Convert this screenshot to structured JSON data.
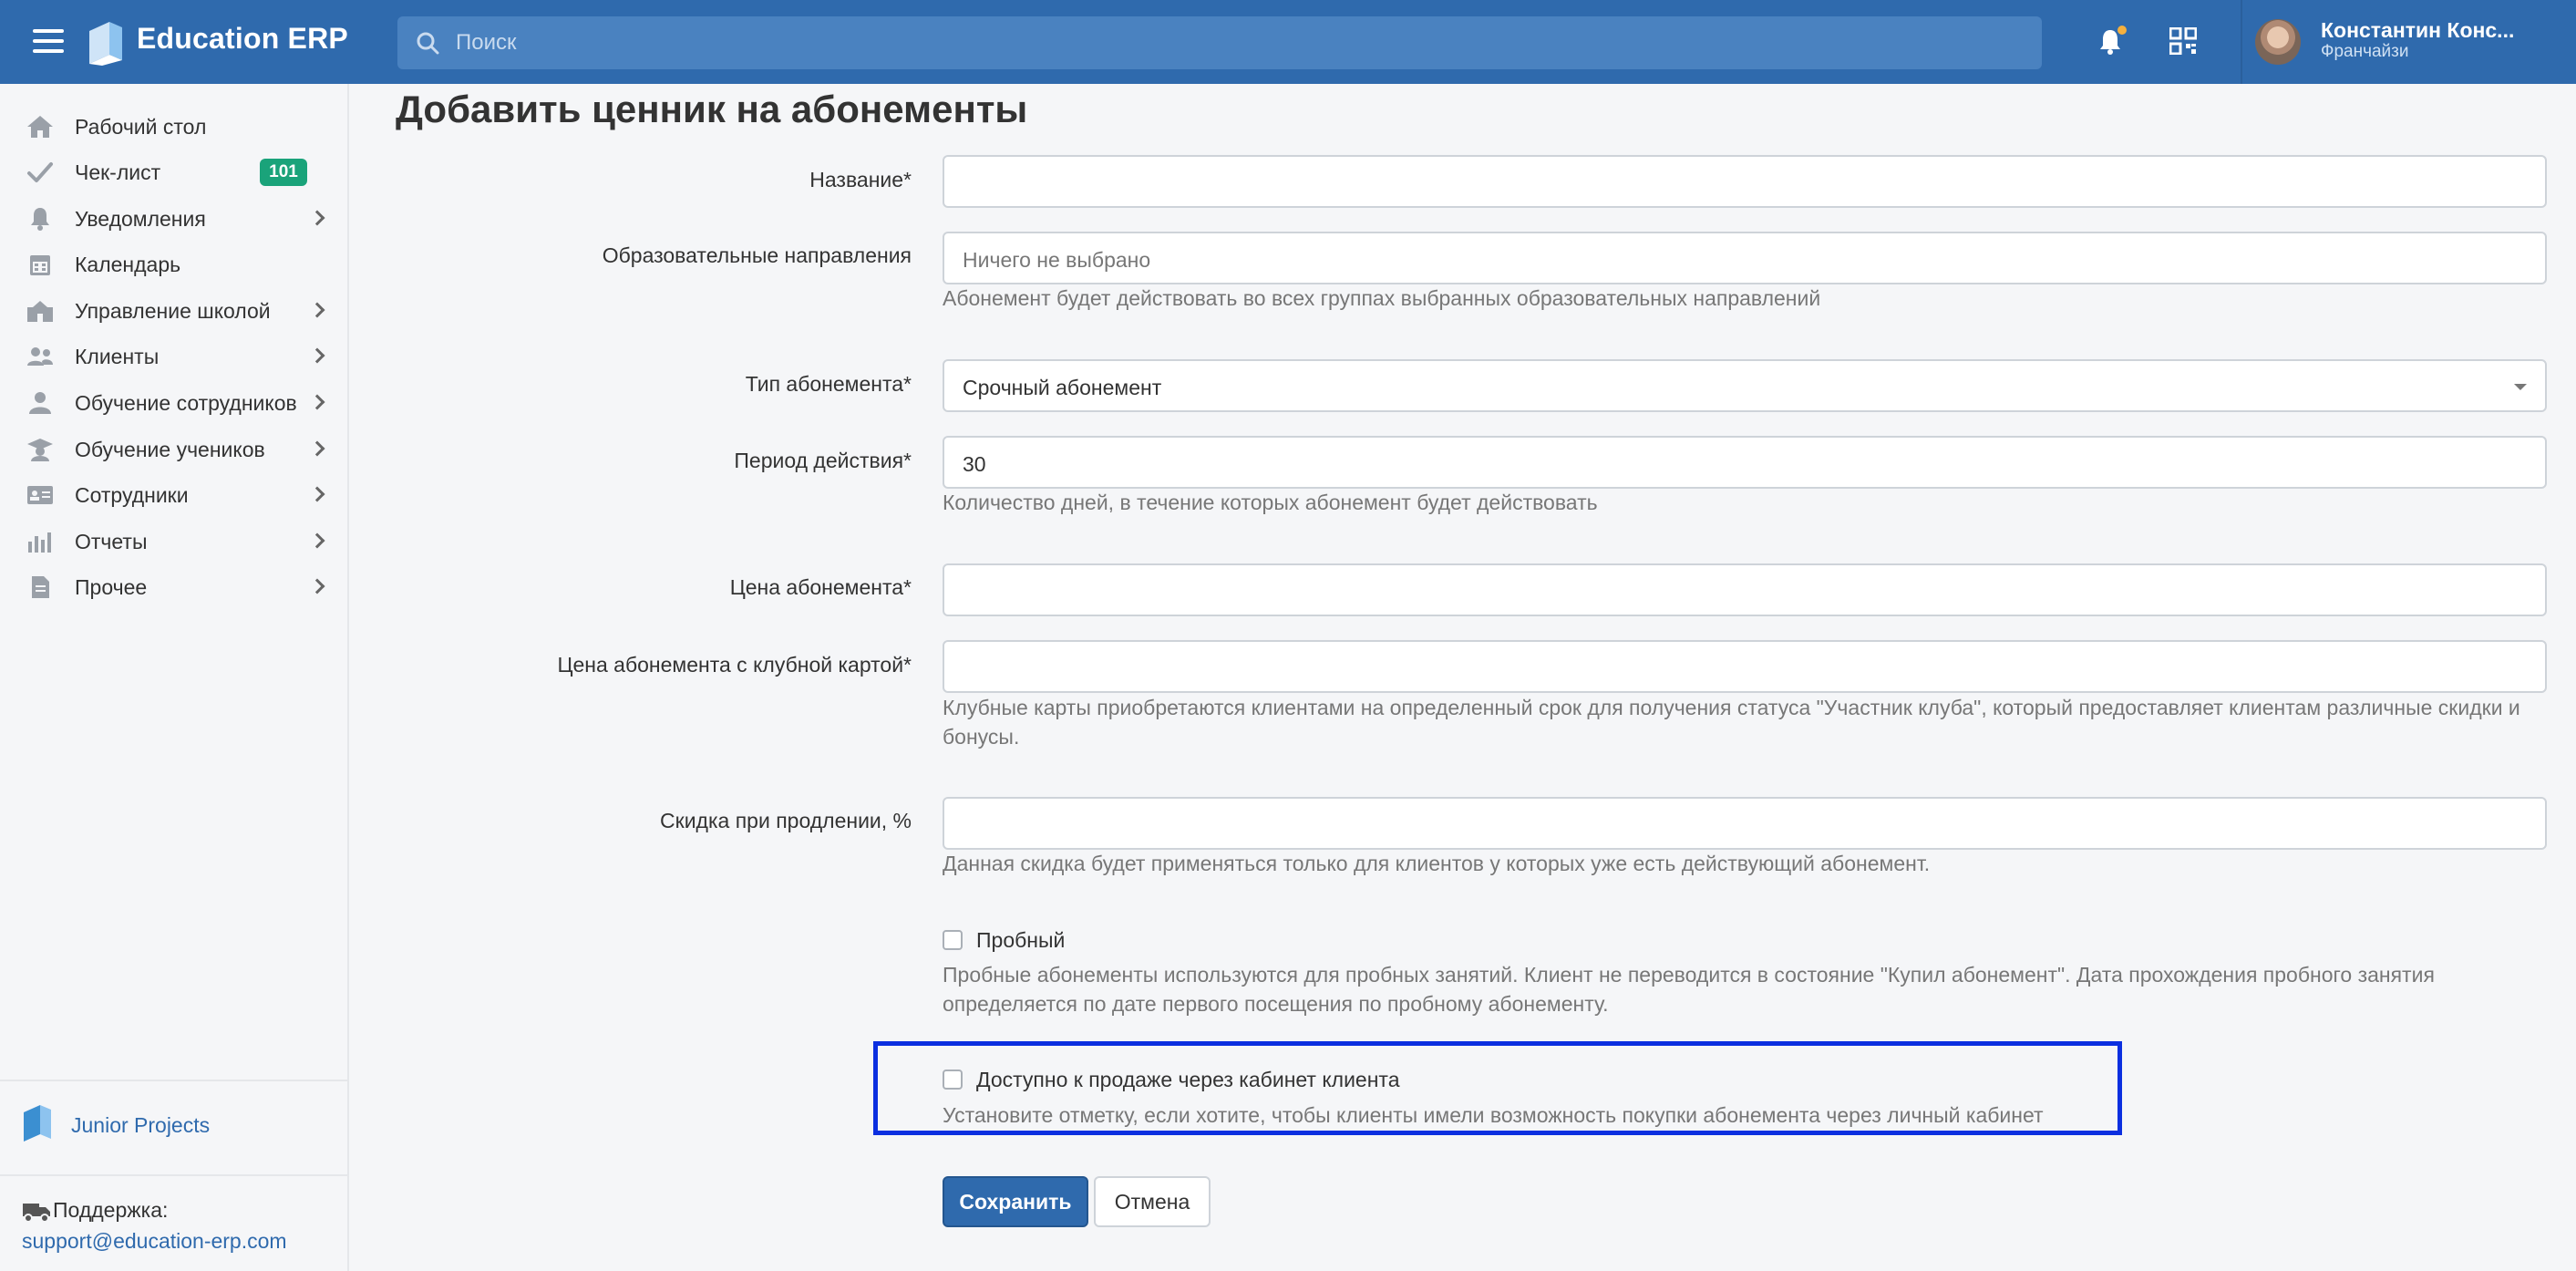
{
  "header": {
    "brand": "Education ERP",
    "search_placeholder": "Поиск",
    "user_name": "Константин Конс...",
    "user_role": "Франчайзи"
  },
  "sidebar": {
    "items": [
      {
        "label": "Рабочий стол",
        "icon": "home-icon"
      },
      {
        "label": "Чек-лист",
        "icon": "checkmark-icon",
        "badge": "101"
      },
      {
        "label": "Уведомления",
        "icon": "bell-icon"
      },
      {
        "label": "Календарь",
        "icon": "calendar-icon"
      },
      {
        "label": "Управление школой",
        "icon": "school-icon"
      },
      {
        "label": "Клиенты",
        "icon": "users-icon"
      },
      {
        "label": "Обучение сотрудников",
        "icon": "staff-training-icon"
      },
      {
        "label": "Обучение учеников",
        "icon": "graduation-cap-icon"
      },
      {
        "label": "Сотрудники",
        "icon": "id-card-icon"
      },
      {
        "label": "Отчеты",
        "icon": "bar-chart-icon"
      },
      {
        "label": "Прочее",
        "icon": "document-icon"
      }
    ],
    "company": "Junior Projects",
    "support_label": "Поддержка:",
    "support_email": "support@education-erp.com"
  },
  "form": {
    "title": "Добавить ценник на абонементы",
    "name_label": "Название*",
    "directions_label": "Образовательные направления",
    "directions_placeholder": "Ничего не выбрано",
    "directions_help": "Абонемент будет действовать во всех группах выбранных образовательных направлений",
    "type_label": "Тип абонемента*",
    "type_value": "Срочный абонемент",
    "period_label": "Период действия*",
    "period_value": "30",
    "period_help": "Количество дней, в течение которых абонемент будет действовать",
    "price_label": "Цена абонемента*",
    "club_price_label": "Цена абонемента с клубной картой*",
    "club_price_help": "Клубные карты приобретаются клиентами на определенный срок для получения статуса \"Участник клуба\", который предоставляет клиентам различные скидки и бонусы.",
    "discount_label": "Скидка при продлении, %",
    "discount_help": "Данная скидка будет применяться только для клиентов у которых уже есть действующий абонемент.",
    "trial_label": "Пробный",
    "trial_help": "Пробные абонементы используются для пробных занятий. Клиент не переводится в состояние \"Купил абонемент\". Дата прохождения пробного занятия определяется по дате первого посещения по пробному абонементу.",
    "client_sale_label": "Доступно к продаже через кабинет клиента",
    "client_sale_help": "Установите отметку, если хотите, чтобы клиенты имели возможность покупки абонемента через личный кабинет",
    "save_button": "Сохранить",
    "cancel_button": "Отмена"
  },
  "colors": {
    "topbar": "#2f6aad",
    "badge": "#1aa37a",
    "highlight_border": "#0b2fe0",
    "notification_dot": "#f4b03e"
  }
}
